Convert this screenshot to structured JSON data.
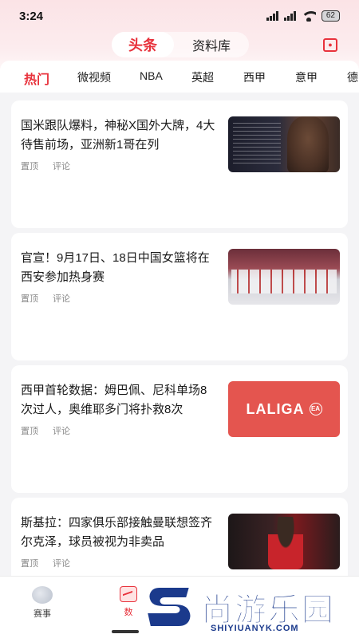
{
  "status_bar": {
    "time": "3:24",
    "battery": "62"
  },
  "top_tabs": {
    "active": "头条",
    "other": "资料库"
  },
  "categories": [
    "热门",
    "微视频",
    "NBA",
    "英超",
    "西甲",
    "意甲",
    "德"
  ],
  "feed": [
    {
      "title": "国米跟队爆料，神秘X国外大牌，4大待售前场，亚洲新1哥在列",
      "pin": "置顶",
      "comment": "评论"
    },
    {
      "title": "官宣！9月17日、18日中国女篮将在西安参加热身赛",
      "pin": "置顶",
      "comment": "评论"
    },
    {
      "title": "西甲首轮数据：姆巴佩、尼科单场8次过人，奥维耶多门将扑救8次",
      "pin": "置顶",
      "comment": "评论",
      "thumb_text": "LALIGA",
      "thumb_badge": "EA"
    },
    {
      "title": "斯基拉：四家俱乐部接触曼联想签齐尔克泽，球员被视为非卖品",
      "pin": "置顶",
      "comment": "评论"
    }
  ],
  "bottom_nav": {
    "item1": "赛事",
    "item2": "数"
  },
  "watermark": {
    "name": "尚游乐园",
    "url": "SHIYIUANYK.COM"
  },
  "colors": {
    "accent": "#e8323c",
    "watermark_blue": "#1b3a8c"
  }
}
